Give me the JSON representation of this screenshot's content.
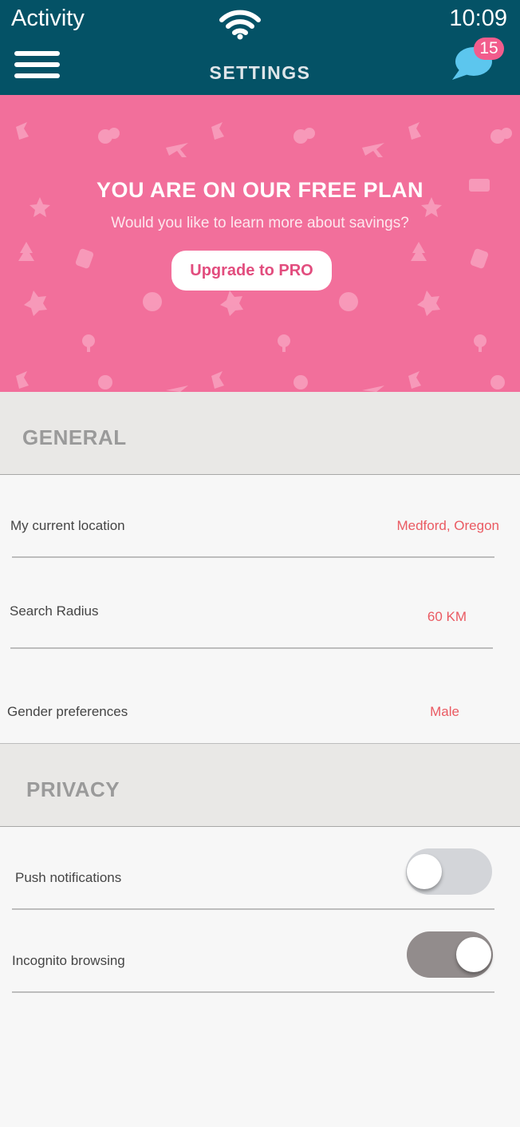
{
  "status_bar": {
    "app_name": "Activity",
    "time": "10:09"
  },
  "header": {
    "title": "SETTINGS",
    "messages_badge": "15"
  },
  "banner": {
    "title": "YOU ARE ON OUR FREE PLAN",
    "subtitle": "Would you like to learn more about savings?",
    "button_label": "Upgrade to PRO",
    "background_color": "#f26f9b"
  },
  "general": {
    "heading": "GENERAL",
    "rows": [
      {
        "label": "My current location",
        "value": "Medford, Oregon"
      },
      {
        "label": "Search Radius",
        "value": "60 KM"
      },
      {
        "label": "Gender preferences",
        "value": "Male"
      }
    ]
  },
  "privacy": {
    "heading": "PRIVACY",
    "rows": [
      {
        "label": "Push notifications",
        "enabled": false
      },
      {
        "label": "Incognito browsing",
        "enabled": true
      }
    ]
  },
  "colors": {
    "header": "#045266",
    "accent_value": "#ea5a62",
    "badge": "#f25c8c"
  }
}
